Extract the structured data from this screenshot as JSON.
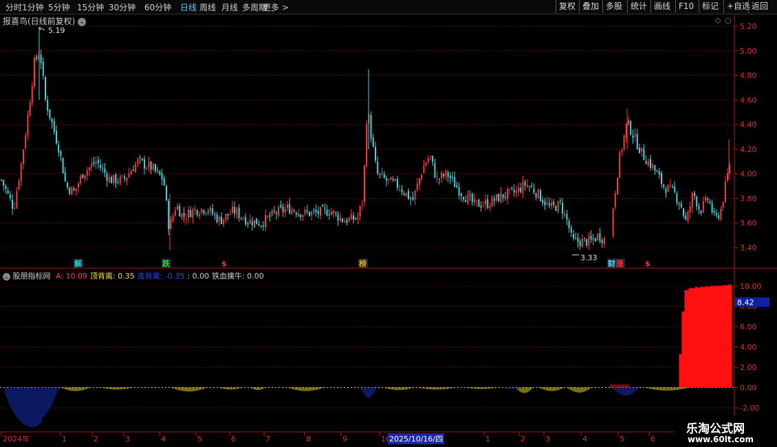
{
  "toolbar": {
    "periods": [
      "分时",
      "1分钟",
      "5分钟",
      "15分钟",
      "30分钟",
      "60分钟",
      "日线",
      "周线",
      "月线",
      "多周期",
      "更多"
    ],
    "active_period": "日线",
    "more_arrow": ">",
    "buttons": [
      "复权",
      "叠加",
      "多股",
      "统计",
      "画线",
      "F10",
      "标记",
      "+自选",
      "返回"
    ]
  },
  "price_panel": {
    "title": "报喜鸟(日线前复权)",
    "high_label": "5.19",
    "low_label": "3.33",
    "y_ticks": [
      "5.20",
      "5.00",
      "4.80",
      "4.60",
      "4.40",
      "4.20",
      "4.00",
      "3.80",
      "3.60",
      "3.40"
    ],
    "y_tick_values": [
      5.2,
      5.0,
      4.8,
      4.6,
      4.4,
      4.2,
      4.0,
      3.8,
      3.6,
      3.4
    ],
    "markers": [
      {
        "text": "解",
        "color": "#20d0d0"
      },
      {
        "text": "跌",
        "color": "#30d030"
      },
      {
        "text": "$",
        "color": "#ff3030"
      },
      {
        "text": "榜",
        "color": "#e0a020"
      },
      {
        "text": "财",
        "color": "#4fd0ff"
      },
      {
        "text": "涨",
        "color": "#ff3030"
      },
      {
        "text": "$",
        "color": "#ff3030"
      }
    ],
    "colors": {
      "up": "#ff3b3b",
      "down": "#40d8e0",
      "grid": "#7a1010",
      "axis": "#b01818"
    }
  },
  "indicator_panel": {
    "name": "股朋指标网",
    "items": [
      {
        "label": "A: 10.09",
        "color": "#ff4040"
      },
      {
        "label": "顶背离: 0.35",
        "color": "#f0e040"
      },
      {
        "label": "底背离: -0.35",
        "color": "#3040ff"
      },
      {
        "label": ": 0.00",
        "color": "#d0d0d0"
      },
      {
        "label": "铁血擒牛: 0.00",
        "color": "#d0d0d0"
      }
    ],
    "y_ticks": [
      "10.00",
      "8.00",
      "6.00",
      "4.00",
      "2.00",
      "0.00",
      "-2.00"
    ],
    "y_tick_values": [
      10,
      8,
      6,
      4,
      2,
      0,
      -2
    ],
    "current_value": "8.42",
    "colors": {
      "a": "#ff1010",
      "top": "#f0e020",
      "bottom": "#1830c0"
    }
  },
  "date_axis": {
    "labels": [
      "2024年",
      "1",
      "2",
      "3",
      "4",
      "5",
      "6",
      "7",
      "8",
      "9",
      "10",
      "2025/10/16/四",
      "1",
      "2",
      "3",
      "4",
      "5",
      "6"
    ],
    "highlight": "2025/10/16/四"
  },
  "watermark": {
    "title": "乐淘公式网",
    "url": "www.60lt.com"
  }
}
